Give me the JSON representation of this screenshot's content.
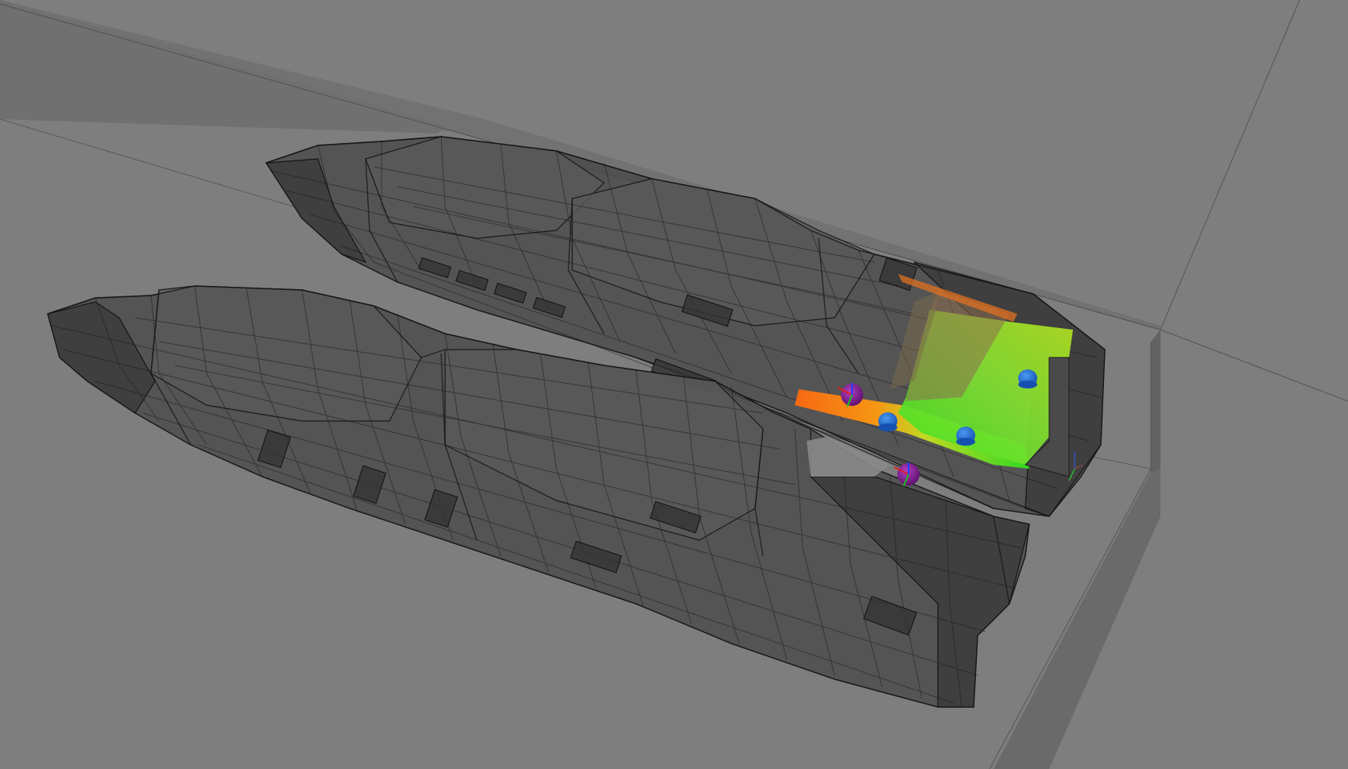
{
  "viewport": {
    "background_color": "#7e7e7e",
    "floor_color": "#8a8a8a",
    "wall_color": "#6e6e6e"
  },
  "models": [
    {
      "id": "upper-hull",
      "color": "#4a4a4a"
    },
    {
      "id": "lower-hull",
      "color": "#4a4a4a"
    }
  ],
  "heatmap": {
    "colors": [
      "#1ee01e",
      "#7ee020",
      "#e8d020",
      "#ff7a10",
      "#ff3a10"
    ]
  },
  "markers": [
    {
      "id": "blue-marker-1",
      "color": "#1e6fe0"
    },
    {
      "id": "blue-marker-2",
      "color": "#1e6fe0"
    },
    {
      "id": "blue-marker-3",
      "color": "#1e6fe0"
    },
    {
      "id": "purple-marker-1",
      "color": "#7a1a8a"
    },
    {
      "id": "purple-marker-2",
      "color": "#7a1a8a"
    }
  ]
}
